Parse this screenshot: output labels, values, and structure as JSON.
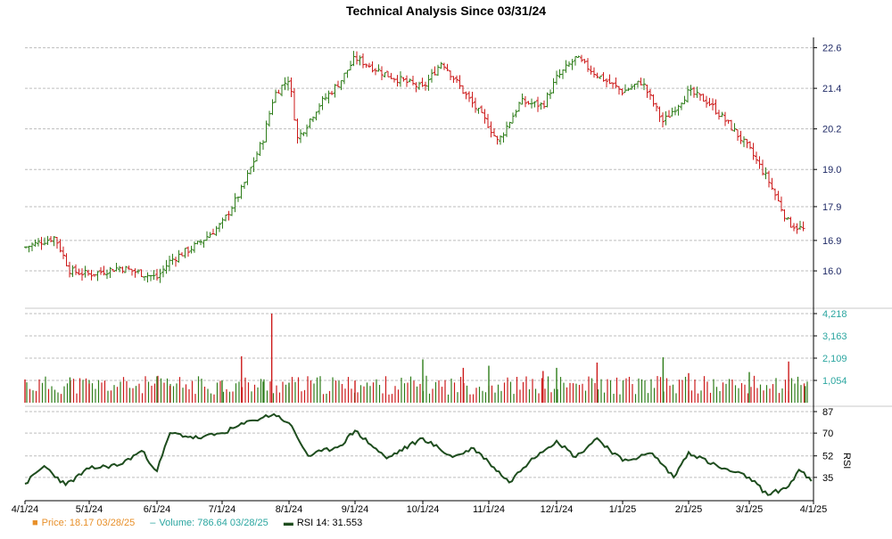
{
  "chart_data": {
    "type": "line",
    "title": "Technical Analysis Since 03/31/24",
    "x_tick_labels": [
      "4/1/24",
      "5/1/24",
      "6/1/24",
      "7/1/24",
      "8/1/24",
      "9/1/24",
      "10/1/24",
      "11/1/24",
      "12/1/24",
      "1/1/25",
      "2/1/25",
      "3/1/25",
      "4/1/25"
    ],
    "panels": [
      {
        "name": "Price",
        "chart_kind": "ohlc-bars",
        "y_tick_labels": [
          "22.6",
          "21.4",
          "20.2",
          "19.0",
          "17.9",
          "16.9",
          "16.0"
        ],
        "ylim": [
          15.0,
          22.8
        ],
        "grid": true,
        "up_color": "#2e7d1a",
        "down_color": "#cc1a1a",
        "series": [
          {
            "name": "Price",
            "x": [
              "4/1/24",
              "4/15/24",
              "4/22/24",
              "5/1/24",
              "5/15/24",
              "6/1/24",
              "6/7/24",
              "6/20/24",
              "7/1/24",
              "7/10/24",
              "7/20/24",
              "7/25/24",
              "8/1/24",
              "8/5/24",
              "8/15/24",
              "8/25/24",
              "9/1/24",
              "9/15/24",
              "10/1/24",
              "10/10/24",
              "10/20/24",
              "11/1/24",
              "11/5/24",
              "11/15/24",
              "11/25/24",
              "12/1/24",
              "12/10/24",
              "12/20/24",
              "1/1/25",
              "1/10/25",
              "1/20/25",
              "2/1/25",
              "2/10/25",
              "2/20/25",
              "3/1/25",
              "3/10/25",
              "3/20/25",
              "3/28/25"
            ],
            "close": [
              16.7,
              17.0,
              16.0,
              15.9,
              16.1,
              15.8,
              16.3,
              16.8,
              17.4,
              18.4,
              19.9,
              21.2,
              21.7,
              19.9,
              20.9,
              21.6,
              22.3,
              21.8,
              21.4,
              22.2,
              21.3,
              20.3,
              19.8,
              21.0,
              20.9,
              21.7,
              22.3,
              21.8,
              21.3,
              21.6,
              20.4,
              21.3,
              21.0,
              20.3,
              19.6,
              18.7,
              17.4,
              17.2
            ]
          }
        ]
      },
      {
        "name": "Volume",
        "chart_kind": "bar",
        "y_tick_labels": [
          "4,218",
          "3,163",
          "2,109",
          "1,054"
        ],
        "ylim": [
          0,
          4218
        ],
        "grid": true,
        "series": [
          {
            "name": "Volume",
            "x": [
              "4/1/24",
              "4/22/24",
              "5/1/24",
              "6/1/24",
              "6/7/24",
              "7/1/24",
              "7/10/24",
              "7/20/24",
              "7/24/24",
              "8/1/24",
              "9/1/24",
              "10/1/24",
              "10/20/24",
              "11/1/24",
              "11/25/24",
              "12/1/24",
              "12/20/24",
              "1/20/25",
              "2/1/25",
              "3/1/25",
              "3/20/25",
              "3/28/25"
            ],
            "values": [
              1100,
              1200,
              900,
              1250,
              800,
              1050,
              2200,
              1000,
              4218,
              950,
              1050,
              2050,
              1650,
              1750,
              1500,
              1650,
              1900,
              2150,
              1400,
              1450,
              1950,
              786.64
            ]
          }
        ]
      },
      {
        "name": "RSI 14",
        "chart_kind": "line",
        "y_tick_labels": [
          "87",
          "70",
          "52",
          "35"
        ],
        "ylim": [
          18,
          87
        ],
        "grid": true,
        "series": [
          {
            "name": "RSI 14",
            "x": [
              "4/1/24",
              "4/10/24",
              "4/20/24",
              "5/1/24",
              "5/15/24",
              "5/25/24",
              "6/1/24",
              "6/7/24",
              "6/20/24",
              "7/1/24",
              "7/15/24",
              "7/25/24",
              "8/1/24",
              "8/10/24",
              "8/25/24",
              "9/1/24",
              "9/15/24",
              "10/1/24",
              "10/15/24",
              "10/25/24",
              "11/1/24",
              "11/10/24",
              "11/20/24",
              "12/1/24",
              "12/10/24",
              "12/20/24",
              "1/1/25",
              "1/15/25",
              "1/25/25",
              "2/1/25",
              "2/15/25",
              "3/1/25",
              "3/10/25",
              "3/20/25",
              "3/25/25",
              "3/31/25"
            ],
            "values": [
              30,
              44,
              29,
              42,
              45,
              56,
              40,
              70,
              66,
              70,
              80,
              85,
              78,
              52,
              60,
              72,
              50,
              66,
              51,
              58,
              47,
              31,
              50,
              64,
              51,
              66,
              48,
              54,
              35,
              55,
              43,
              35,
              21,
              28,
              41,
              32
            ]
          }
        ]
      }
    ],
    "legend": [
      {
        "label": "Price: 18.17  03/28/25",
        "color": "#e8902a",
        "marker": "square"
      },
      {
        "label": "Volume: 786.64  03/28/25",
        "color": "#2ba6a0",
        "marker": "dash"
      },
      {
        "label": "RSI 14: 31.553",
        "color": "#1e4d1e",
        "marker": "line"
      }
    ]
  }
}
